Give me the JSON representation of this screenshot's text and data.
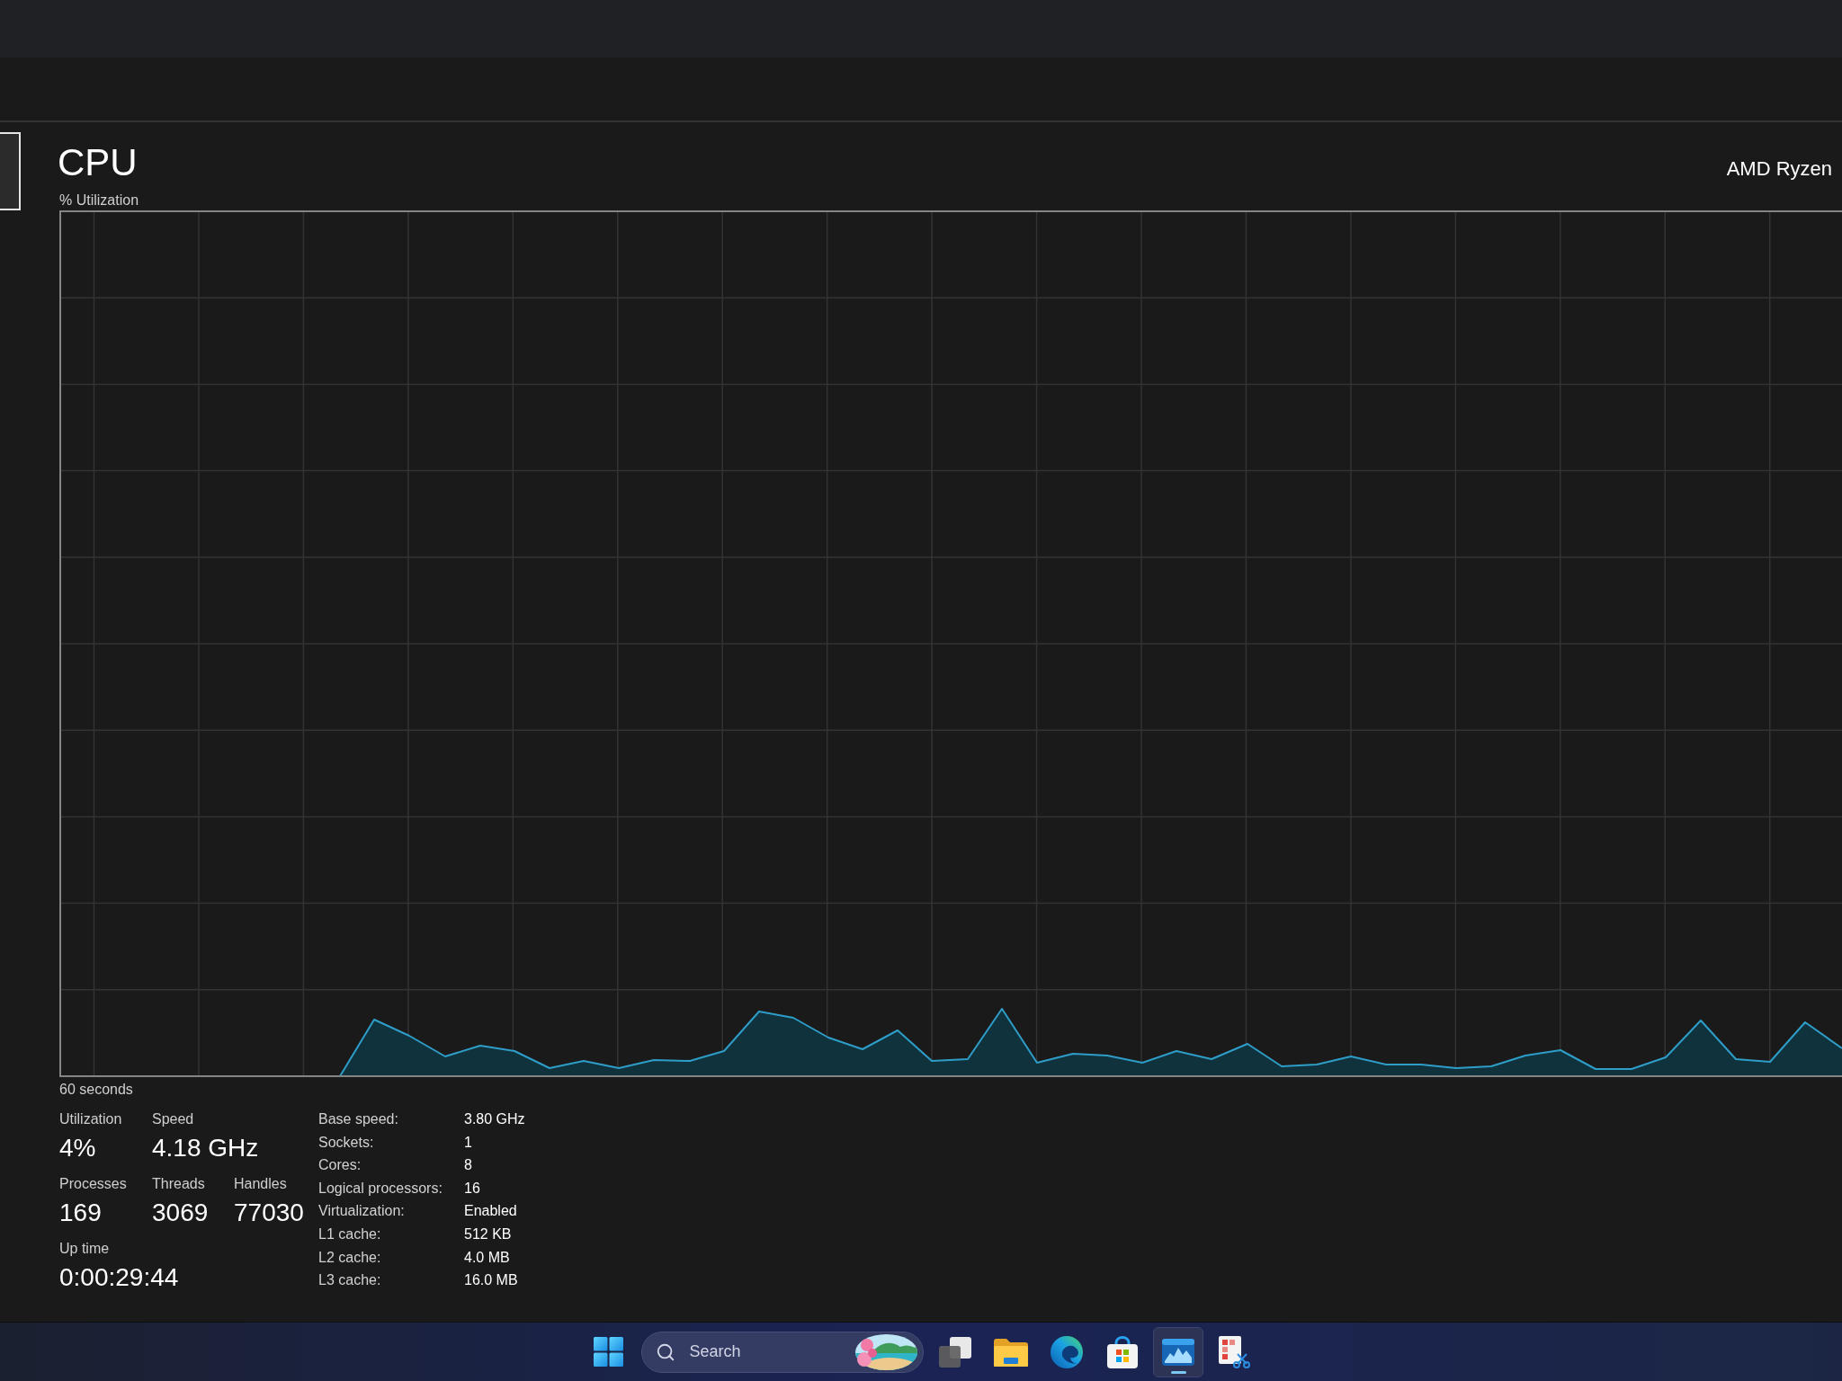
{
  "sidebar": {
    "items": [
      {
        "selected": true
      }
    ]
  },
  "performance": {
    "title": "CPU",
    "processor": "AMD Ryzen",
    "graph": {
      "label": "% Utilization",
      "time_span": "60 seconds"
    },
    "stats": [
      [
        {
          "label": "Utilization",
          "value": "4%"
        },
        {
          "label": "Speed",
          "value": "4.18 GHz"
        }
      ],
      [
        {
          "label": "Processes",
          "value": "169"
        },
        {
          "label": "Threads",
          "value": "3069"
        },
        {
          "label": "Handles",
          "value": "77030"
        }
      ],
      [
        {
          "label": "Up time",
          "value": "0:00:29:44"
        }
      ]
    ],
    "specs": [
      {
        "label": "Base speed:",
        "value": "3.80 GHz"
      },
      {
        "label": "Sockets:",
        "value": "1"
      },
      {
        "label": "Cores:",
        "value": "8"
      },
      {
        "label": "Logical processors:",
        "value": "16"
      },
      {
        "label": "Virtualization:",
        "value": "Enabled"
      },
      {
        "label": "L1 cache:",
        "value": "512 KB"
      },
      {
        "label": "L2 cache:",
        "value": "4.0 MB"
      },
      {
        "label": "L3 cache:",
        "value": "16.0 MB"
      }
    ]
  },
  "taskbar": {
    "search": {
      "placeholder": "Search"
    },
    "apps": [
      {
        "selected": false
      },
      {
        "selected": false
      },
      {
        "selected": false
      },
      {
        "selected": false
      },
      {
        "selected": true
      },
      {
        "selected": false
      }
    ]
  }
}
